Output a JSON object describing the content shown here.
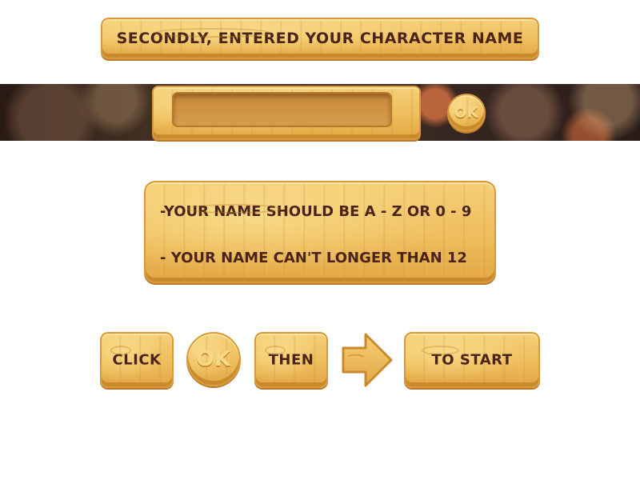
{
  "title_banner": {
    "text": "SECONDLY, ENTERED YOUR CHARACTER NAME"
  },
  "name_entry": {
    "value": "",
    "ok_label": "OK"
  },
  "rules": {
    "line1": "-YOUR NAME SHOULD BE A - Z OR 0 - 9",
    "line2": "- YOUR NAME CAN'T LONGER THAN 12"
  },
  "instructions": {
    "click_label": "CLICK",
    "ok_label": "OK",
    "then_label": "THEN",
    "arrow_icon": "arrow-right-icon",
    "start_label": "TO START"
  },
  "colors": {
    "wood": "#eebd5c",
    "wood_dark": "#c98a2c",
    "text": "#4a2418",
    "background": "#ffffff"
  }
}
